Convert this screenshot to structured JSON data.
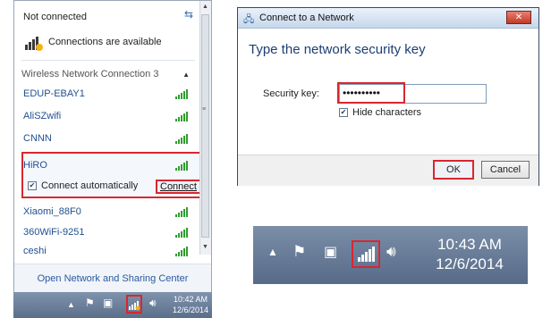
{
  "flyout": {
    "status": "Not connected",
    "refresh_icon": "refresh-icon",
    "connections_available": "Connections are available",
    "section_header": "Wireless Network Connection 3",
    "networks": [
      {
        "name": "EDUP-EBAY1",
        "signal": 4
      },
      {
        "name": "AliSZwifi",
        "signal": 4
      },
      {
        "name": "CNNN",
        "signal": 4
      },
      {
        "name": "HiRO",
        "signal": 4,
        "selected": true
      },
      {
        "name": "Xiaomi_88F0",
        "signal": 4
      },
      {
        "name": "360WiFi-9251",
        "signal": 4
      },
      {
        "name": "ceshi",
        "signal": 4
      }
    ],
    "connect_automatically": "Connect automatically",
    "connect_automatically_checked": true,
    "connect_button": "Connect",
    "footer_link": "Open Network and Sharing Center"
  },
  "taskbar_small": {
    "time": "10:42 AM",
    "date": "12/6/2014"
  },
  "dialog": {
    "title": "Connect to a Network",
    "close_label": "✕",
    "heading": "Type the network security key",
    "security_key_label": "Security key:",
    "security_key_value": "••••••••••",
    "hide_characters": "Hide characters",
    "hide_characters_checked": true,
    "ok": "OK",
    "cancel": "Cancel"
  },
  "taskbar_big": {
    "time": "10:43 AM",
    "date": "12/6/2014"
  },
  "colors": {
    "highlight": "#d9262f",
    "signal": "#2f9e2f",
    "link": "#1f4f8f",
    "taskbar": "#6a7f9b"
  }
}
